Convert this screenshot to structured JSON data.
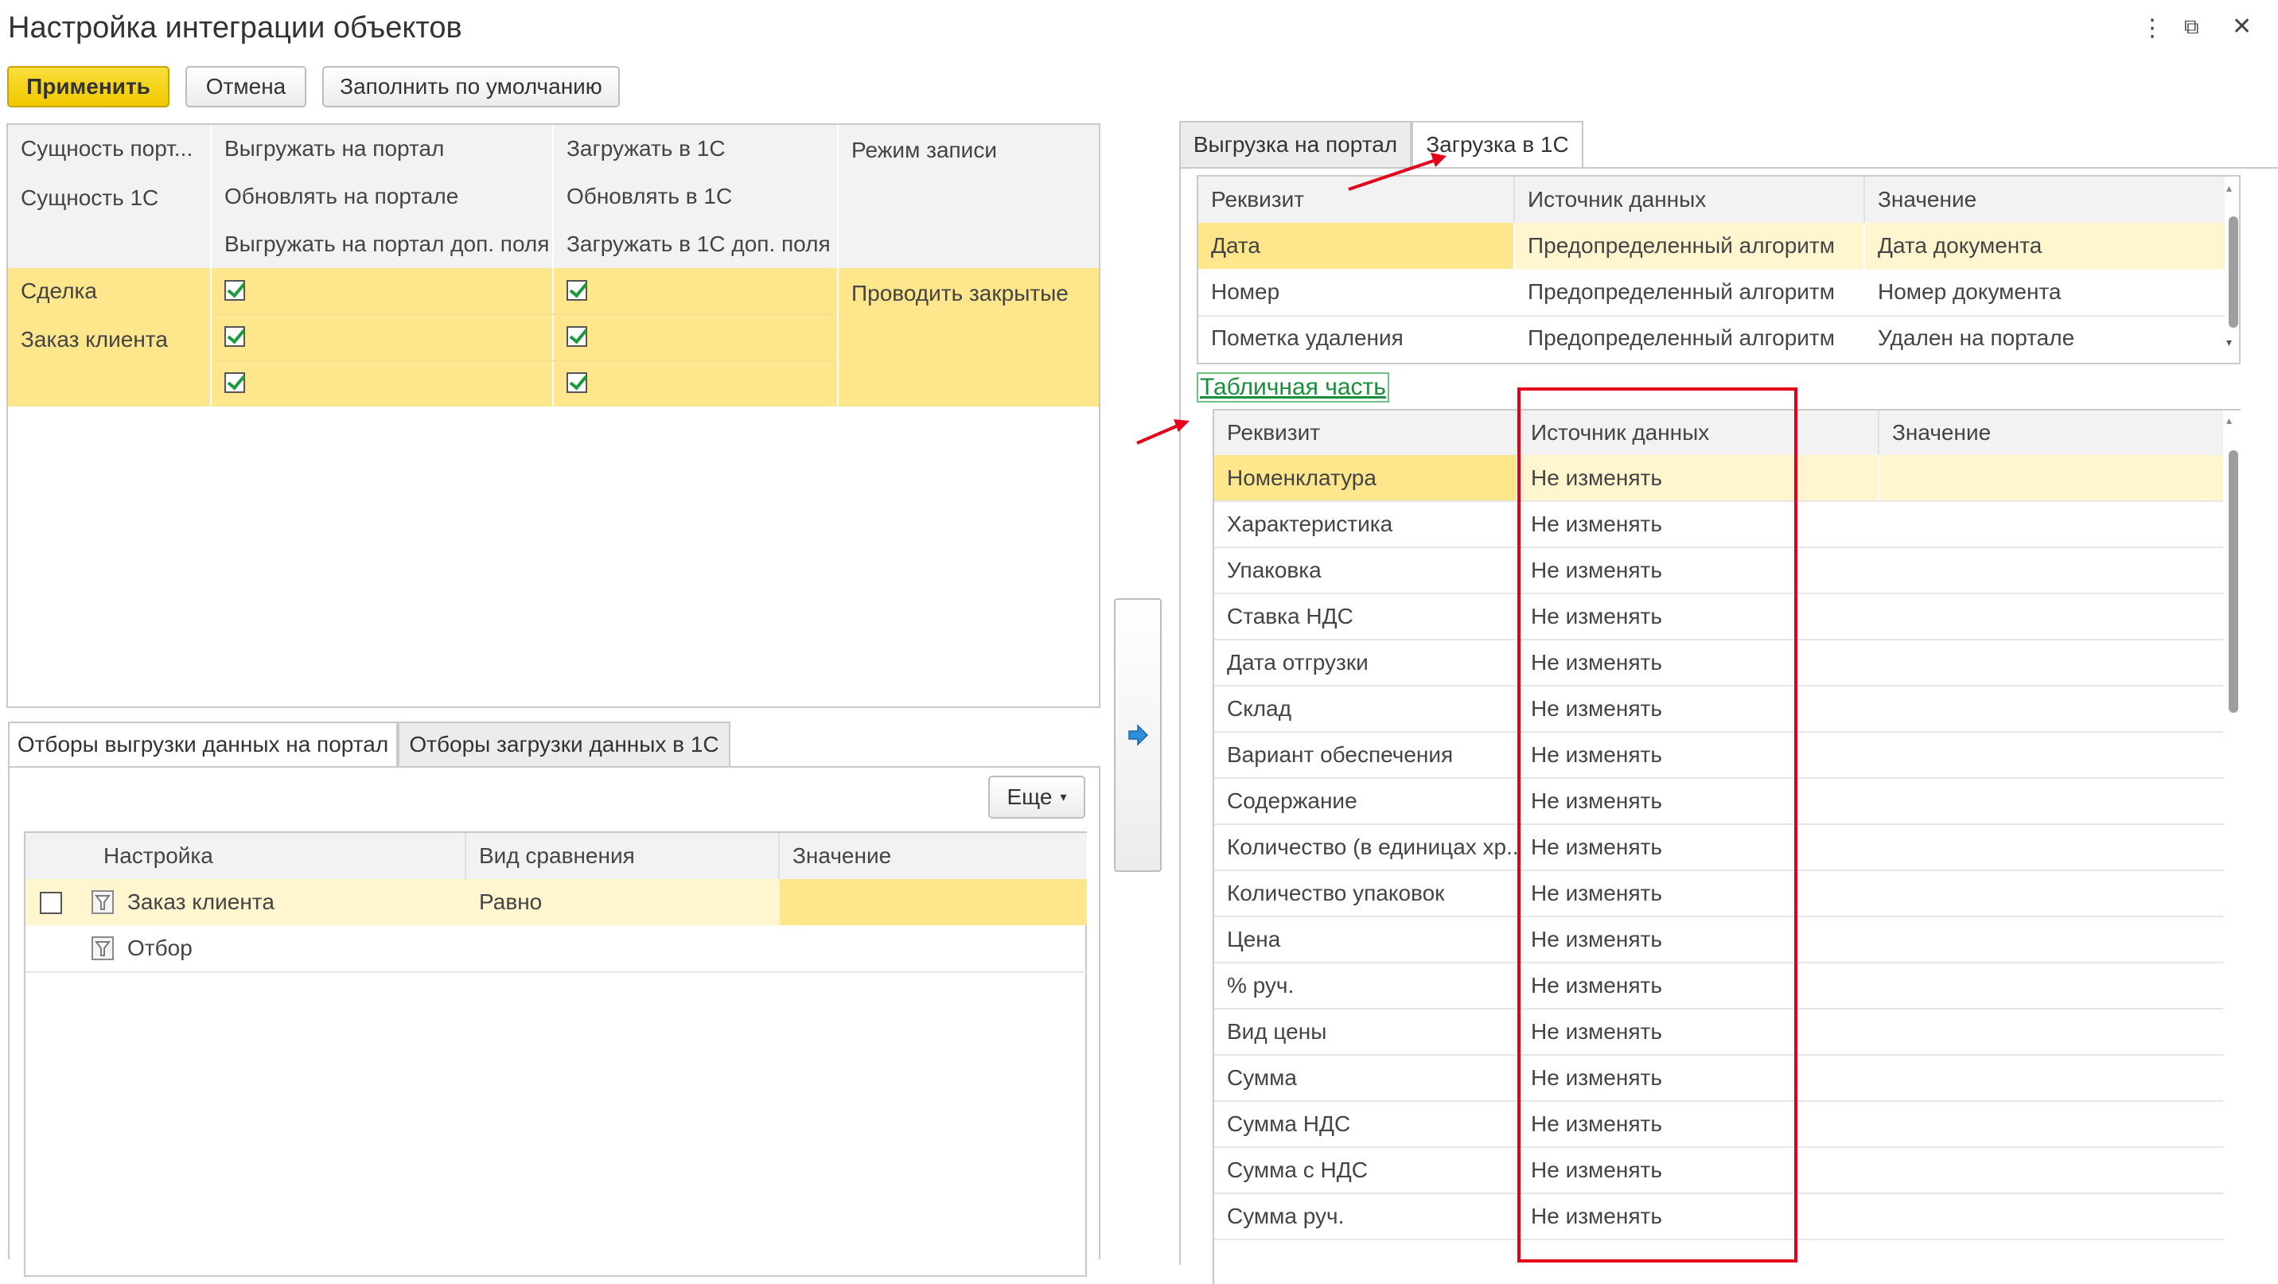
{
  "window": {
    "title": "Настройка интеграции объектов",
    "controls": [
      "⋮",
      "⧉",
      "✕"
    ]
  },
  "toolbar": {
    "apply": "Применить",
    "cancel": "Отмена",
    "fill_default": "Заполнить по умолчанию"
  },
  "entities": {
    "headers": {
      "col1_r1": "Сущность порт...",
      "col1_r2": "Сущность 1С",
      "col2_r1": "Выгружать на портал",
      "col2_r2": "Обновлять на портале",
      "col2_r3": "Выгружать на портал доп. поля",
      "col3_r1": "Загружать в 1С",
      "col3_r2": "Обновлять в 1С",
      "col3_r3": "Загружать в 1С доп. поля",
      "col4_r1": "Режим записи"
    },
    "row": {
      "portal_entity": "Сделка",
      "entity_1c": "Заказ клиента",
      "mode": "Проводить закрытые",
      "upload_portal": true,
      "update_portal": true,
      "upload_portal_extra": true,
      "load_1c": true,
      "update_1c": true,
      "load_1c_extra": true
    }
  },
  "filters": {
    "tabs": [
      "Отборы выгрузки данных на портал",
      "Отборы загрузки данных в 1С"
    ],
    "more_button": "Еще",
    "columns": [
      "Настройка",
      "Вид сравнения",
      "Значение"
    ],
    "rows": [
      {
        "setting": "Заказ клиента",
        "comparison": "Равно",
        "value": "",
        "checked": false
      },
      {
        "setting": "Отбор",
        "comparison": "",
        "value": ""
      }
    ]
  },
  "right": {
    "tabs": [
      "Выгрузка на портал",
      "Загрузка в 1С"
    ],
    "active_tab": 1,
    "header_table": {
      "columns": [
        "Реквизит",
        "Источник данных",
        "Значение"
      ],
      "rows": [
        {
          "attr": "Дата",
          "source": "Предопределенный алгоритм",
          "value": "Дата документа"
        },
        {
          "attr": "Номер",
          "source": "Предопределенный алгоритм",
          "value": "Номер документа"
        },
        {
          "attr": "Пометка удаления",
          "source": "Предопределенный алгоритм",
          "value": "Удален на портале"
        }
      ]
    },
    "tabular_link": "Табличная часть",
    "tabular_table": {
      "columns": [
        "Реквизит",
        "Источник данных",
        "Значение"
      ],
      "rows": [
        {
          "attr": "Номенклатура",
          "source": "Не изменять",
          "value": ""
        },
        {
          "attr": "Характеристика",
          "source": "Не изменять",
          "value": ""
        },
        {
          "attr": "Упаковка",
          "source": "Не изменять",
          "value": ""
        },
        {
          "attr": "Ставка НДС",
          "source": "Не изменять",
          "value": ""
        },
        {
          "attr": "Дата отгрузки",
          "source": "Не изменять",
          "value": ""
        },
        {
          "attr": "Склад",
          "source": "Не изменять",
          "value": ""
        },
        {
          "attr": "Вариант обеспечения",
          "source": "Не изменять",
          "value": ""
        },
        {
          "attr": "Содержание",
          "source": "Не изменять",
          "value": ""
        },
        {
          "attr": "Количество (в единицах хр...",
          "source": "Не изменять",
          "value": ""
        },
        {
          "attr": "Количество упаковок",
          "source": "Не изменять",
          "value": ""
        },
        {
          "attr": "Цена",
          "source": "Не изменять",
          "value": ""
        },
        {
          "attr": "% руч.",
          "source": "Не изменять",
          "value": ""
        },
        {
          "attr": "Вид цены",
          "source": "Не изменять",
          "value": ""
        },
        {
          "attr": "Сумма",
          "source": "Не изменять",
          "value": ""
        },
        {
          "attr": "Сумма НДС",
          "source": "Не изменять",
          "value": ""
        },
        {
          "attr": "Сумма с НДС",
          "source": "Не изменять",
          "value": ""
        },
        {
          "attr": "Сумма руч.",
          "source": "Не изменять",
          "value": ""
        }
      ]
    }
  },
  "colors": {
    "accent_yellow": "#f0c900",
    "selection": "#fde68b",
    "highlight": "#fff6cf",
    "annotation_red": "#e3001b",
    "link_green": "#1a8f3b"
  }
}
